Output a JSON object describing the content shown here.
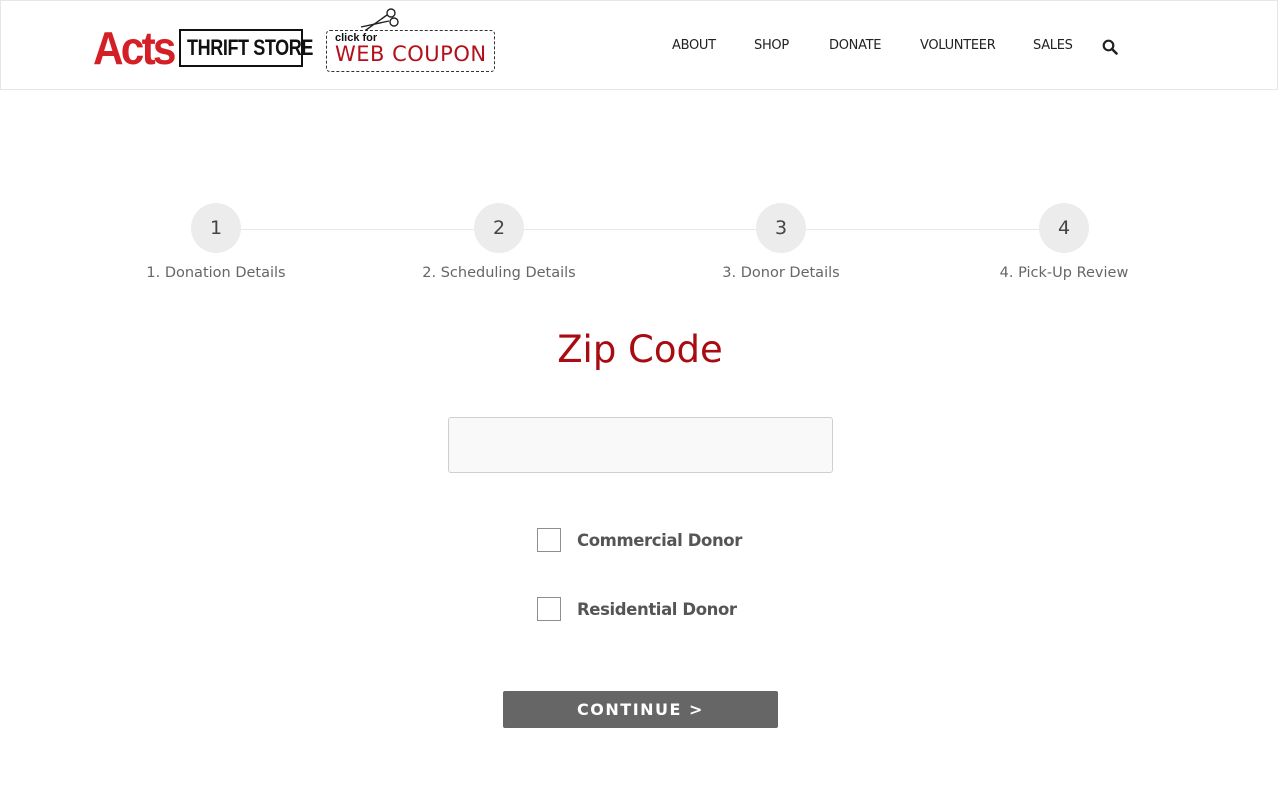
{
  "header": {
    "logo": {
      "brand": "Acts",
      "subtitle": "THRIFT STORE"
    },
    "coupon": {
      "small": "click for",
      "big": "WEB COUPON"
    },
    "nav": [
      "ABOUT",
      "SHOP",
      "DONATE",
      "VOLUNTEER",
      "SALES"
    ]
  },
  "steps": [
    {
      "number": "1",
      "label": "1. Donation Details"
    },
    {
      "number": "2",
      "label": "2. Scheduling Details"
    },
    {
      "number": "3",
      "label": "3. Donor Details"
    },
    {
      "number": "4",
      "label": "4. Pick-Up Review"
    }
  ],
  "form": {
    "title": "Zip Code",
    "zip_value": "",
    "options": [
      {
        "label": "Commercial Donor",
        "checked": false
      },
      {
        "label": "Residential Donor",
        "checked": false
      }
    ],
    "continue_label": "CONTINUE >"
  },
  "colors": {
    "brand_red": "#d41f26",
    "title_red": "#a80c12",
    "button_gray": "#666666"
  }
}
